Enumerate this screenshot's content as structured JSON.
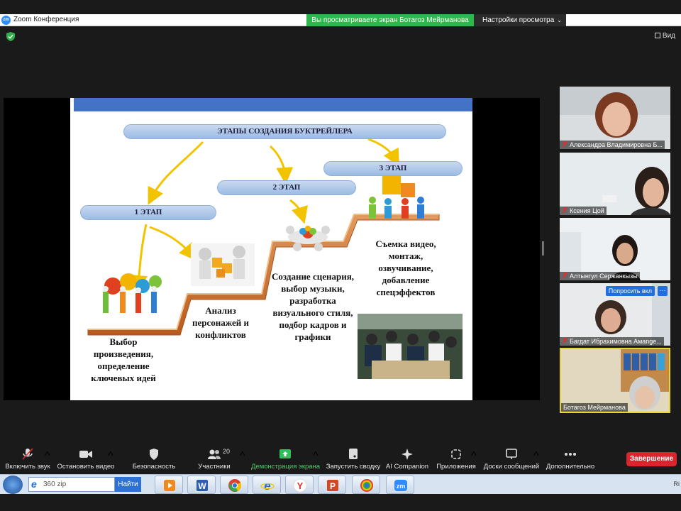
{
  "window": {
    "app_title": "Zoom Конференция",
    "logo_text": "zm",
    "share_banner": "Вы просматриваете экран Ботагоз Мейрманова",
    "view_options": "Настройки просмотра",
    "view_button": "Вид"
  },
  "slide": {
    "title": "ЭТАПЫ СОЗДАНИЯ  БУКТРЕЙЛЕРА",
    "stage1": "1 ЭТАП",
    "stage2": "2 ЭТАП",
    "stage3": "3 ЭТАП",
    "step1_text": "Выбор произведения, определение ключевых идей",
    "step2_text": "Анализ персонажей и конфликтов",
    "step3_text": "Создание сценария, выбор музыки, разработка визуального стиля, подбор кадров и графики",
    "step4_text": "Съемка видео, монтаж, озвучивание, добавление спецэффектов",
    "accent_color": "#4472c4",
    "stair_color": "#c8692b"
  },
  "participants": [
    {
      "name": "Александра Владимировна Б...",
      "muted": true
    },
    {
      "name": "Ксения Цой",
      "muted": true
    },
    {
      "name": "Алтынгул Сержанкызы",
      "muted": true
    },
    {
      "name": "Багдат Ибрахимовна Амange...",
      "muted": true,
      "ask_unmute": "Попросить вкл",
      "more": "···"
    },
    {
      "name": "Ботагоз Мейрманова",
      "muted": false,
      "active_speaker": true
    }
  ],
  "toolbar": {
    "unmute": "Включить звук",
    "stop_video": "Остановить видео",
    "security": "Безопасность",
    "participants": "Участники",
    "participants_count": "20",
    "share_screen": "Демонстрация экрана",
    "summary": "Запустить сводку",
    "ai_companion": "AI Companion",
    "apps": "Приложения",
    "whiteboards": "Доски сообщений",
    "more": "Дополнительно",
    "end": "Завершение"
  },
  "taskbar": {
    "search_value": "360 zip",
    "search_button": "Найти",
    "tray_text": "Ri"
  }
}
